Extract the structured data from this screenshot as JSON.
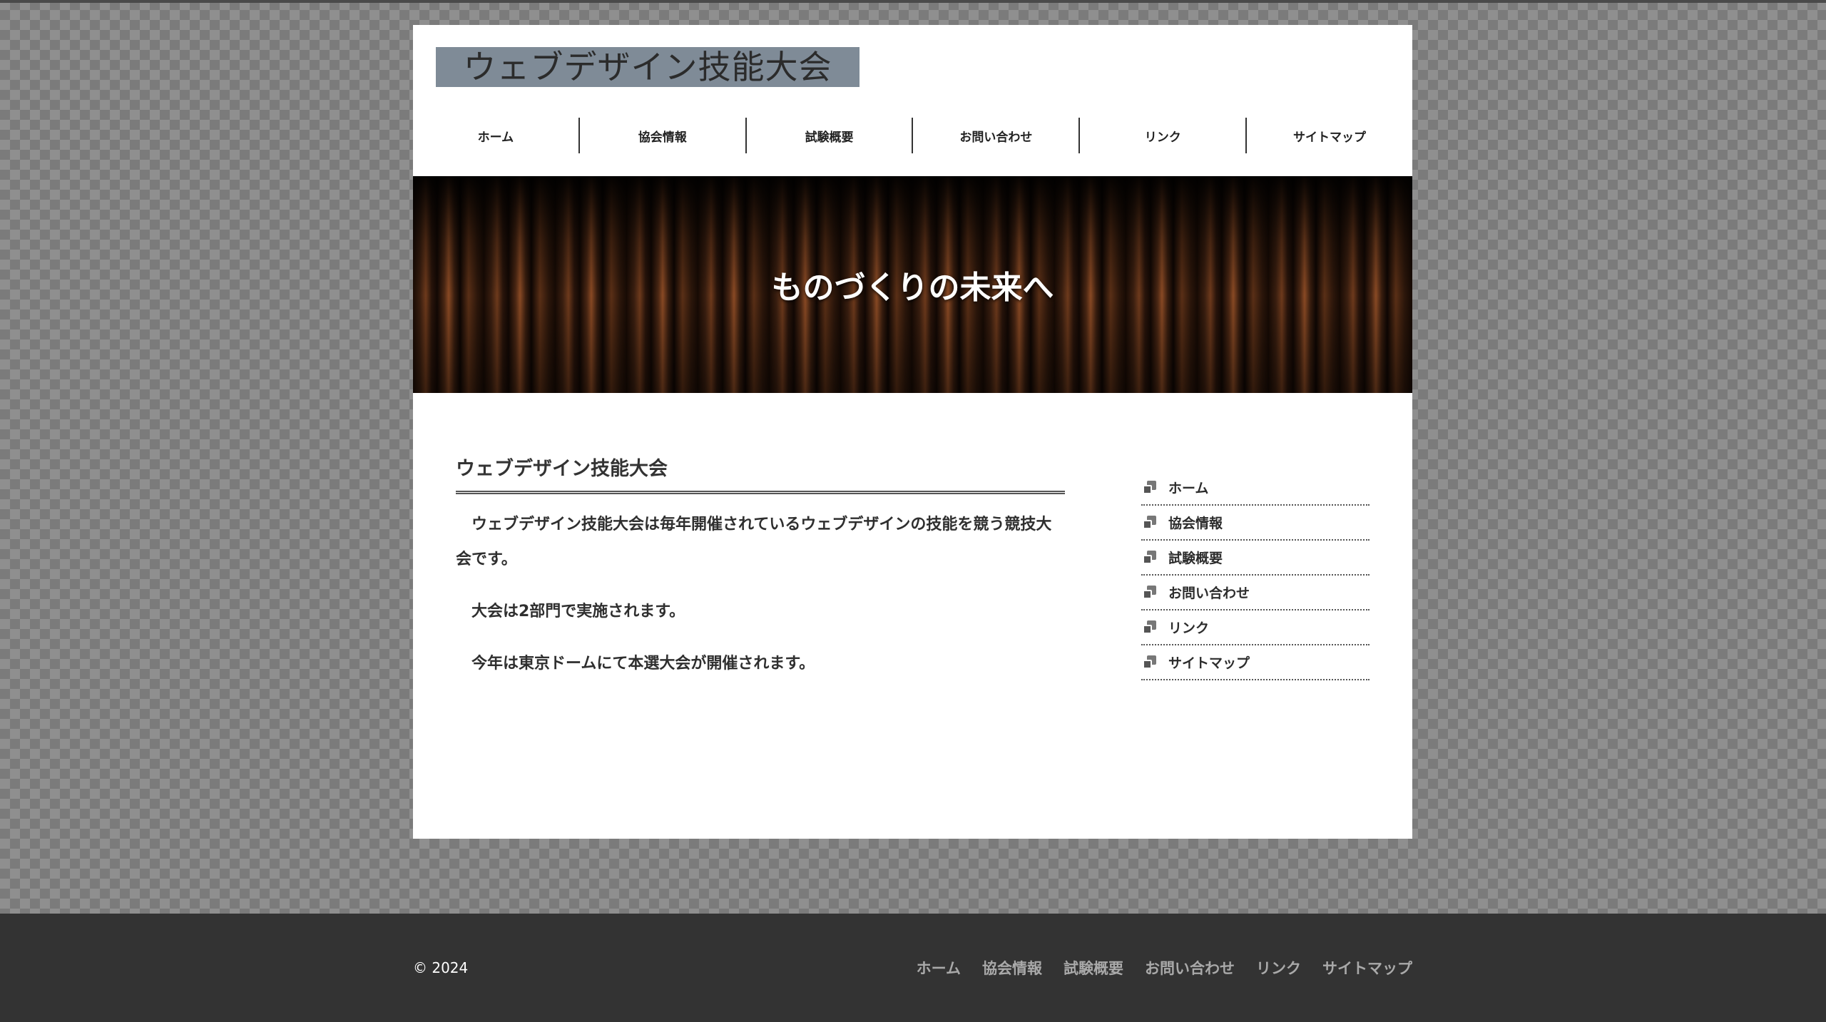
{
  "header": {
    "logo_text": "ウェブデザイン技能大会"
  },
  "global_nav": {
    "items": [
      {
        "label": "ホーム"
      },
      {
        "label": "協会情報"
      },
      {
        "label": "試験概要"
      },
      {
        "label": "お問い合わせ"
      },
      {
        "label": "リンク"
      },
      {
        "label": "サイトマップ"
      }
    ]
  },
  "hero": {
    "title": "ものづくりの未来へ"
  },
  "main": {
    "heading": "ウェブデザイン技能大会",
    "paragraphs": [
      "ウェブデザイン技能大会は毎年開催されているウェブデザインの技能を競う競技大会です。",
      "大会は2部門で実施されます。",
      "今年は東京ドームにて本選大会が開催されます。"
    ]
  },
  "side_nav": {
    "items": [
      {
        "label": "ホーム"
      },
      {
        "label": "協会情報"
      },
      {
        "label": "試験概要"
      },
      {
        "label": "お問い合わせ"
      },
      {
        "label": "リンク"
      },
      {
        "label": "サイトマップ"
      }
    ]
  },
  "footer": {
    "copyright": "© 2024",
    "links": [
      {
        "label": "ホーム"
      },
      {
        "label": "協会情報"
      },
      {
        "label": "試験概要"
      },
      {
        "label": "お問い合わせ"
      },
      {
        "label": "リンク"
      },
      {
        "label": "サイトマップ"
      }
    ]
  },
  "colors": {
    "logo_background": "#7f8b97",
    "footer_background": "#333333",
    "footer_link": "#a9a9a9",
    "hero_background": "#2a150b"
  },
  "icons": {
    "side_nav_bullet": "stacked-squares-icon"
  }
}
